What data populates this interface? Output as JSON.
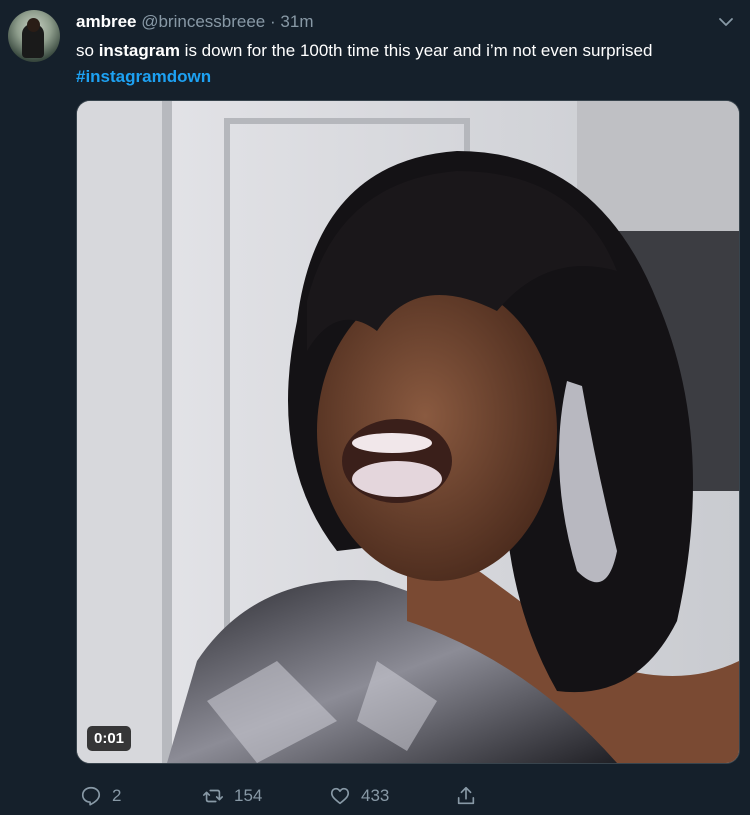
{
  "tweet": {
    "author": {
      "name": "ambree",
      "handle": "@brincessbreee",
      "separator": "·",
      "time": "31m"
    },
    "text": {
      "p1": "so ",
      "bold": "instagram",
      "p2": " is down for the 100th time this year and i’m not even surprised ",
      "hashtag": "#instagramdown"
    },
    "media": {
      "duration": "0:01"
    },
    "actions": {
      "replies": "2",
      "retweets": "154",
      "likes": "433"
    }
  },
  "colors": {
    "background": "#15202b",
    "secondary_text": "#8899a6",
    "link": "#1da1f2"
  },
  "icons": [
    "chevron-down-icon",
    "reply-icon",
    "retweet-icon",
    "like-icon",
    "share-icon"
  ]
}
